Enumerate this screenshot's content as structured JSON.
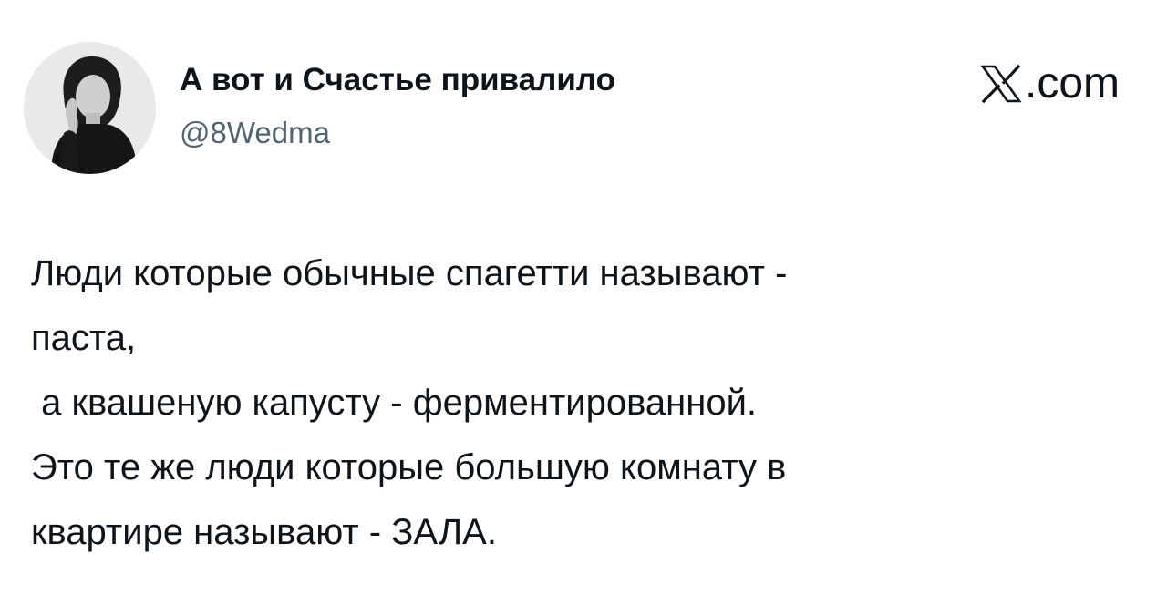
{
  "tweet": {
    "author": {
      "display_name": "А вот и Счастье привалило",
      "handle": "@8Wedma",
      "avatar": "woman-portrait-avatar"
    },
    "brand": {
      "logo": "x-logo-icon",
      "domain": ".com"
    },
    "text_lines": [
      "Люди которые обычные спагетти называют -",
      "паста,",
      " а квашеную капусту - ферментированной.",
      "Это те же люди которые большую комнату в",
      "квартире называют - ЗАЛА."
    ]
  },
  "colors": {
    "background": "#ffffff",
    "text_primary": "#0f1419",
    "text_secondary": "#536471"
  }
}
